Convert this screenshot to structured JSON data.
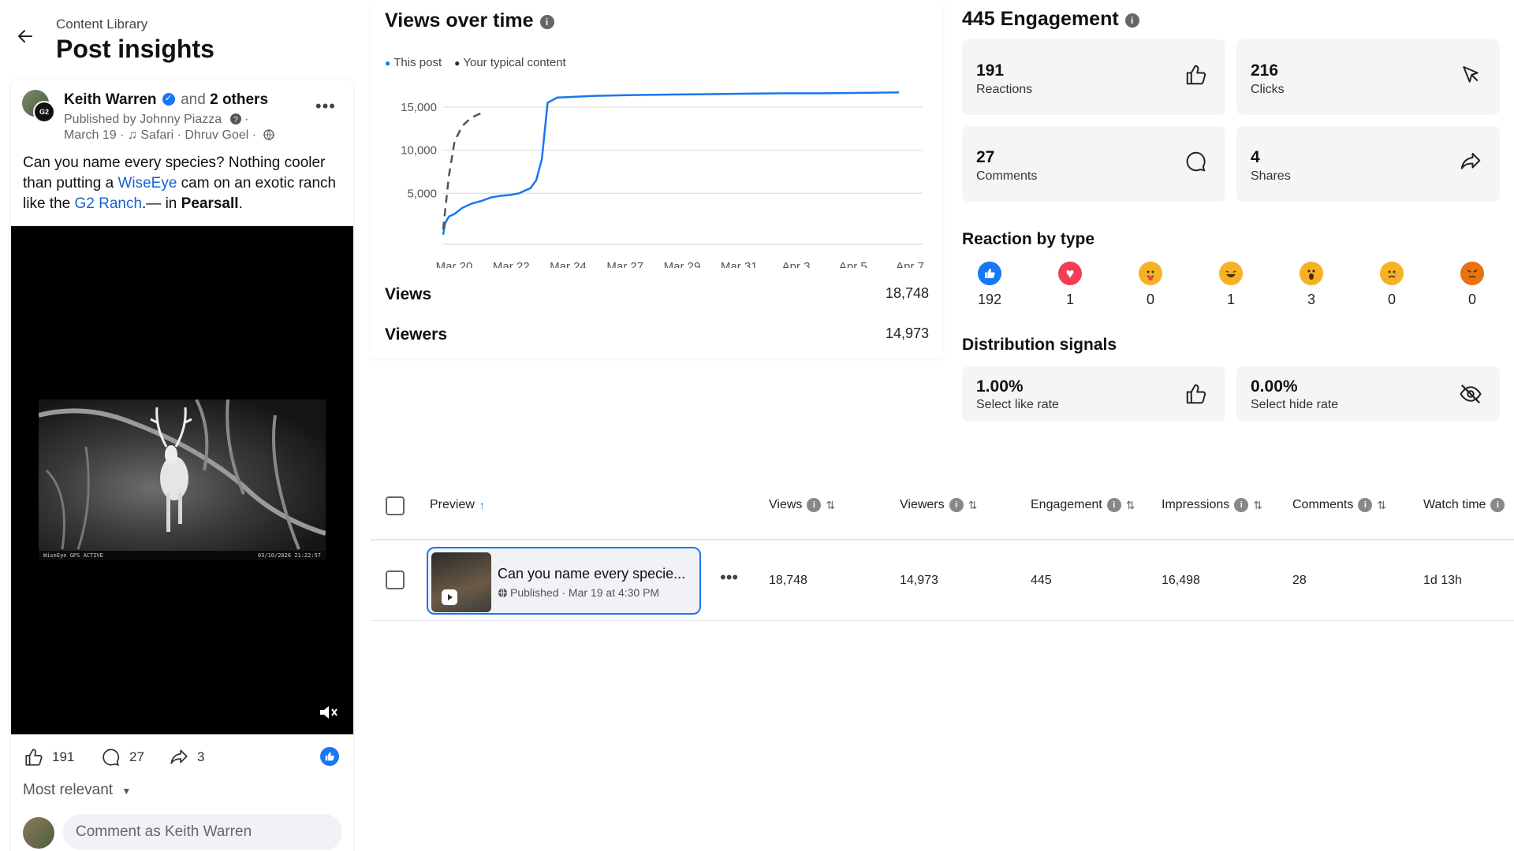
{
  "header": {
    "breadcrumb": "Content Library",
    "title": "Post insights"
  },
  "post": {
    "author": "Keith Warren",
    "and_text": "and",
    "others": "2 others",
    "published_by": "Published by Johnny Piazza",
    "date_line": "March 19 · ♫ Safari · Dhruv Goel ·",
    "text_1": "Can you name every species? Nothing cooler than putting a ",
    "link_1": "WiseEye",
    "text_2": " cam on an exotic ranch like the ",
    "link_2": "G2 Ranch",
    "text_3": ".— in ",
    "place": "Pearsall",
    "text_4": ".",
    "cam_brand": "WiseEye  GPS ACTIVE",
    "cam_stamp": "03/10/2026  21:22:57",
    "likes": "191",
    "comments": "27",
    "shares": "3",
    "sort_label": "Most relevant",
    "comment_placeholder": "Comment as Keith Warren"
  },
  "views": {
    "title": "Views over time",
    "legend": [
      "This post",
      "Your typical content"
    ],
    "views_label": "Views",
    "views_value": "18,748",
    "viewers_label": "Viewers",
    "viewers_value": "14,973"
  },
  "chart_data": {
    "type": "line",
    "categories": [
      "Mar 20",
      "Mar 22",
      "Mar 24",
      "Mar 27",
      "Mar 29",
      "Mar 31",
      "Apr 3",
      "Apr 5",
      "Apr 7"
    ],
    "y_ticks": [
      "15,000",
      "10,000",
      "5,000"
    ],
    "ylim": [
      0,
      17000
    ],
    "grid": true,
    "legend_position": "top-left",
    "series": [
      {
        "name": "This post",
        "color": "#1877f2",
        "dashed": false,
        "x": [
          0,
          0.1,
          0.3,
          0.6,
          1,
          1.5,
          2,
          2.5,
          3,
          3.5,
          4,
          4.3,
          4.6,
          4.9,
          5.2,
          5.5,
          6,
          7,
          8,
          10,
          12,
          14,
          16,
          18,
          20,
          22,
          24
        ],
        "values": [
          200,
          1500,
          2300,
          2600,
          3300,
          3800,
          4100,
          4500,
          4700,
          4800,
          5000,
          5300,
          5600,
          6500,
          9000,
          15500,
          16100,
          16200,
          16300,
          16400,
          16450,
          16500,
          16550,
          16600,
          16600,
          16650,
          16700
        ]
      },
      {
        "name": "Your typical content",
        "color": "#555555",
        "dashed": true,
        "x": [
          0,
          0.3,
          0.6,
          1,
          1.5,
          2
        ],
        "values": [
          800,
          7000,
          11000,
          12800,
          13800,
          14300
        ]
      }
    ]
  },
  "engagement": {
    "title": "445 Engagement",
    "tiles": [
      {
        "num": "191",
        "label": "Reactions",
        "icon": "thumbs-up-icon"
      },
      {
        "num": "216",
        "label": "Clicks",
        "icon": "cursor-icon"
      },
      {
        "num": "27",
        "label": "Comments",
        "icon": "comment-icon"
      },
      {
        "num": "4",
        "label": "Shares",
        "icon": "share-icon"
      }
    ],
    "reaction_title": "Reaction by type",
    "reactions": [
      {
        "name": "like",
        "count": "192",
        "color": "#1877f2",
        "glyph": "👍"
      },
      {
        "name": "love",
        "count": "1",
        "color": "#f33e58",
        "glyph": "♥"
      },
      {
        "name": "care",
        "count": "0",
        "color": "#f7b125",
        "glyph": "🤗"
      },
      {
        "name": "haha",
        "count": "1",
        "color": "#f7b125",
        "glyph": "😆"
      },
      {
        "name": "wow",
        "count": "3",
        "color": "#f7b125",
        "glyph": "😮"
      },
      {
        "name": "sad",
        "count": "0",
        "color": "#f7b125",
        "glyph": "😢"
      },
      {
        "name": "angry",
        "count": "0",
        "color": "#e9710f",
        "glyph": "😡"
      }
    ],
    "dist_title": "Distribution signals",
    "dist_tiles": [
      {
        "num": "1.00%",
        "label": "Select like rate",
        "icon": "thumbs-up-icon"
      },
      {
        "num": "0.00%",
        "label": "Select hide rate",
        "icon": "eye-slash-icon"
      }
    ]
  },
  "table": {
    "headers": {
      "preview": "Preview",
      "views": "Views",
      "viewers": "Viewers",
      "engagement": "Engagement",
      "impressions": "Impressions",
      "comments": "Comments",
      "watch_time": "Watch time"
    },
    "row": {
      "title": "Can you name every specie...",
      "subtitle": "Published · Mar 19 at 4:30 PM",
      "views": "18,748",
      "viewers": "14,973",
      "engagement": "445",
      "impressions": "16,498",
      "comments": "28",
      "watch_time": "1d 13h"
    }
  }
}
